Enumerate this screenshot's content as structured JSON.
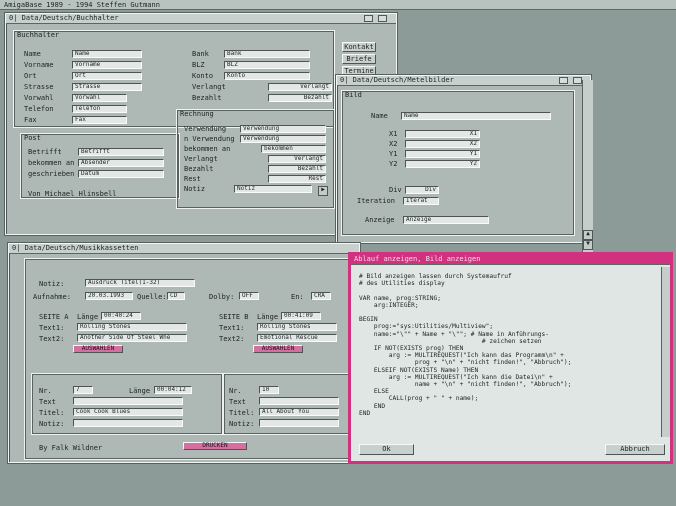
{
  "screen": {
    "title": "AmigaBase  1989 - 1994 Steffen Gutmann"
  },
  "buchhalter": {
    "title": "0| Data/Deutsch/Buchhalter",
    "group_label": "Buchhalter",
    "labels": {
      "name": "Name",
      "vorname": "Vorname",
      "ort": "Ort",
      "strasse": "Strasse",
      "vorwahl": "Vorwahl",
      "telefon": "Telefon",
      "fax": "Fax",
      "bank": "Bank",
      "blz": "BLZ",
      "konto": "Konto",
      "verlangt": "Verlangt",
      "bezahlt": "Bezahlt"
    },
    "values": {
      "name": "Name",
      "vorname": "Vorname",
      "ort": "Ort",
      "strasse": "Strasse",
      "vorwahl": "Vorwahl",
      "telefon": "Telefon",
      "fax": "Fax",
      "bank": "Bank",
      "blz": "BLZ",
      "konto": "Konto",
      "verlangt": "Verlangt",
      "bezahlt": "Bezahlt"
    },
    "buttons": [
      "Kontakt",
      "Briefe",
      "Termine"
    ],
    "post": {
      "title": "Post",
      "labels": [
        "Betrifft",
        "bekommen an",
        "geschrieben an"
      ],
      "values": [
        "Betrifft",
        "Absender",
        "Datum"
      ]
    },
    "rechnung": {
      "title": "Rechnung",
      "labels": [
        "Verwendung",
        "n Verwendung",
        "bekommen an",
        "Verlangt",
        "Bezahlt",
        "Rest",
        "Notiz"
      ],
      "values": [
        "Verwendung",
        "Verwendung",
        "bekommen",
        "Verlangt",
        "Bezahlt",
        "Rest",
        "Notiz"
      ]
    },
    "footer": "Von Michael Hlinsbell"
  },
  "mediabilder": {
    "title": "0| Data/Deutsch/Metelbilder",
    "group_label": "Bild",
    "labels": {
      "name": "Name",
      "x1": "X1",
      "x2": "X2",
      "y1": "Y1",
      "y2": "Y2",
      "div": "Div",
      "iteration": "Iteration",
      "anzeige": "Anzeige"
    },
    "values": {
      "name": "Name",
      "x1": "X1",
      "x2": "X2",
      "y1": "Y1",
      "y2": "Y2",
      "div": "Div",
      "iteration": "Iterat",
      "anzeige": "Anzeige"
    }
  },
  "musikkassetten": {
    "title": "0| Data/Deutsch/Musikkassetten",
    "labels": {
      "notiz": "Notiz:",
      "aufnahme": "Aufnahme:",
      "quelle": "Quelle:",
      "dolby": "Dolby:",
      "en": "En:",
      "seite_a": "SEITE A",
      "seite_b": "SEITE B",
      "laenge": "Länge",
      "text1": "Text1:",
      "text2": "Text2:",
      "nr": "Nr.",
      "text": "Text",
      "titel": "Titel:",
      "notiz2": "Notiz:"
    },
    "values": {
      "notiz": "Ausdruck Titel(1-32)",
      "aufnahme": "20.03.1993",
      "quelle": "CD",
      "dolby": "OFF",
      "en": "CRA",
      "laenge_a": "00:40:24",
      "text1_a": "Rolling Stones",
      "text2_a": "Another Side Of Steel Whe",
      "laenge_b": "00:41:09",
      "text1_b": "Rolling Stones",
      "text2_b": "Emotional Rescue",
      "nr_a": "7",
      "laenge_a2": "00:04:12",
      "titel_a": "Cook Cook Blues",
      "nr_b": "10",
      "titel_b": "All About You"
    },
    "pink_buttons": [
      "AUSWAHLEN",
      "AUSWAHLEN",
      "DRUCKEN"
    ],
    "footer": "By Falk Wildner"
  },
  "editor": {
    "title": "Ablauf anzeigen, Bild anzeigen",
    "code_lines": [
      "# Bild anzeigen lassen durch Systemaufruf",
      "# des Utilities display",
      "",
      "VAR name, prog:STRING;",
      "    arg:INTEGER;",
      "",
      "BEGIN",
      "    prog:=\"sys:Utilities/Multiview\";",
      "    name:=\"\\\"\" + Name + \"\\\"\"; # Name in Anführungs-",
      "                                 # zeichen setzen",
      "    IF NOT(EXISTS prog) THEN",
      "        arg := MULTIREQUEST(\"Ich kann das Programm\\n\" +",
      "               prog + \"\\n\" + \"nicht finden!\", \"Abbruch\");",
      "    ELSEIF NOT(EXISTS Name) THEN",
      "        arg := MULTIREQUEST(\"Ich kann die Datei\\n\" +",
      "               name + \"\\n\" + \"nicht finden!\", \"Abbruch\");",
      "    ELSE",
      "        CALL(prog + \" \" + name);",
      "    END",
      "END"
    ],
    "ok_label": "Ok",
    "cancel_label": "Abbruch"
  }
}
